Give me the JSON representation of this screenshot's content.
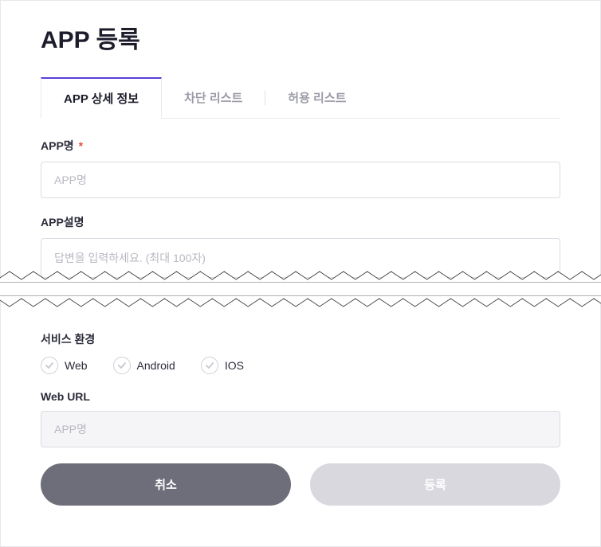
{
  "page": {
    "title": "APP 등록"
  },
  "tabs": {
    "detail": "APP 상세 정보",
    "blocklist": "차단 리스트",
    "allowlist": "허용 리스트"
  },
  "fields": {
    "appName": {
      "label": "APP명",
      "placeholder": "APP명",
      "required": "*"
    },
    "appDesc": {
      "label": "APP설명",
      "placeholder": "답변을 입력하세요. (최대 100자)"
    },
    "serviceEnv": {
      "label": "서비스 환경",
      "options": {
        "web": "Web",
        "android": "Android",
        "ios": "IOS"
      }
    },
    "webUrl": {
      "label": "Web URL",
      "placeholder": "APP명"
    }
  },
  "buttons": {
    "cancel": "취소",
    "submit": "등록"
  }
}
